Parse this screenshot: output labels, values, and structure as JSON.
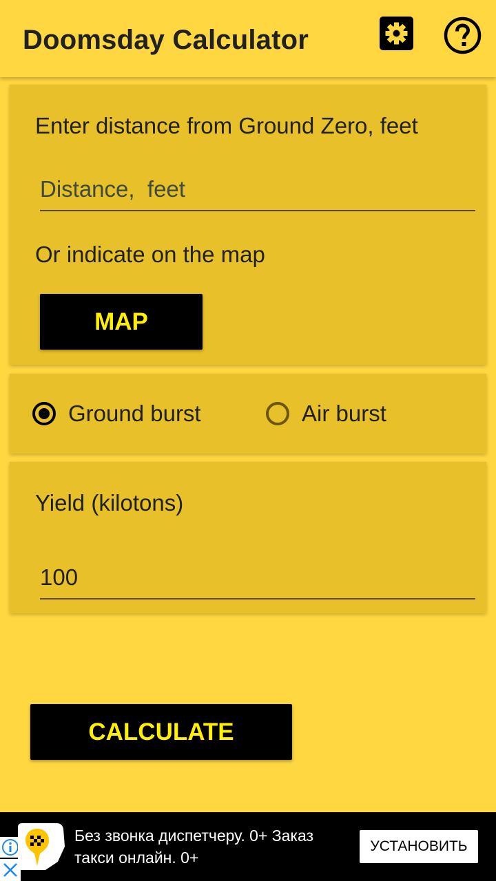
{
  "appbar": {
    "title": "Doomsday Calculator",
    "settings_icon": "gear-icon",
    "help_icon": "help-circle-icon"
  },
  "distance_card": {
    "prompt": "Enter distance from Ground Zero,  feet",
    "input_placeholder": "Distance,  feet",
    "input_value": "",
    "map_prompt": "Or indicate on the map",
    "map_button": "MAP"
  },
  "burst_card": {
    "options": [
      {
        "label": "Ground burst",
        "checked": true
      },
      {
        "label": "Air burst",
        "checked": false
      }
    ]
  },
  "yield_card": {
    "label": "Yield (kilotons)",
    "value": "100"
  },
  "calculate_button": "CALCULATE",
  "ad": {
    "text": "Без звонка диспетчеру. 0+ Заказ такси онлайн. 0+",
    "install_button": "УСТАНОВИТЬ",
    "info_icon": "info-icon",
    "close_icon": "close-icon",
    "logo_icon": "taxi-pin-icon"
  },
  "colors": {
    "background": "#FFD740",
    "card": "#E8C02A",
    "button_bg": "#000000",
    "button_text": "#FFF000"
  }
}
